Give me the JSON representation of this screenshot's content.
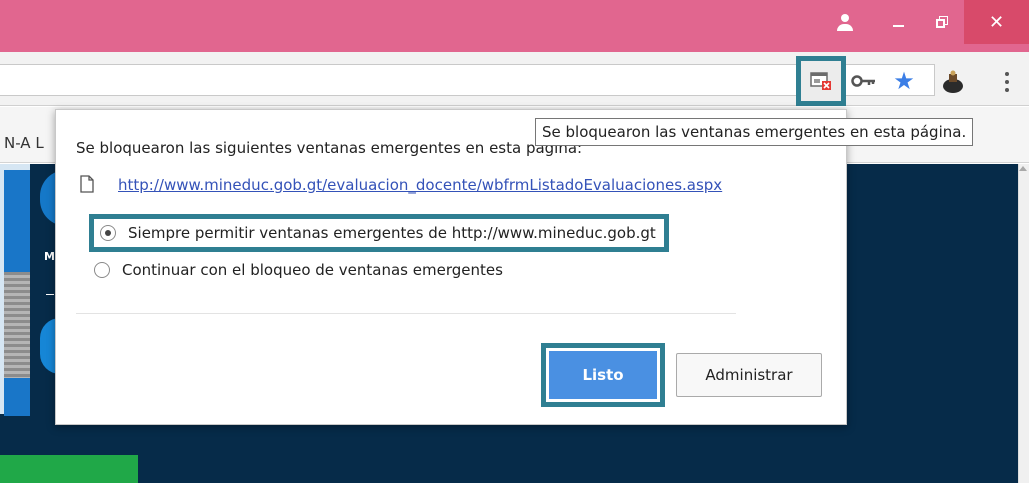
{
  "window": {
    "close_glyph": "✕",
    "title_bar_color": "#e1668f"
  },
  "toolbar": {
    "icons": [
      "popup-blocked-icon",
      "key-icon",
      "star-icon",
      "extension-icon",
      "menu-icon"
    ],
    "star_glyph": "★",
    "accent_color": "#3b7ee6"
  },
  "bookmarks": {
    "partial_label": "N-A L"
  },
  "tooltip": {
    "text": "Se bloquearon las ventanas emergentes en esta página."
  },
  "dialog": {
    "title": "Se bloquearon las siguientes ventanas emergentes en esta página:",
    "blocked_link": "http://www.mineduc.gob.gt/evaluacion_docente/wbfrmListadoEvaluaciones.aspx",
    "options": [
      {
        "label": "Siempre permitir ventanas emergentes de http://www.mineduc.gob.gt",
        "selected": true
      },
      {
        "label": "Continuar con el bloqueo de ventanas emergentes",
        "selected": false
      }
    ],
    "done_button": "Listo",
    "manage_button": "Administrar",
    "highlight_color": "#2f7f92",
    "primary_button_color": "#4a90e2"
  },
  "page": {
    "side_letter": "M"
  }
}
